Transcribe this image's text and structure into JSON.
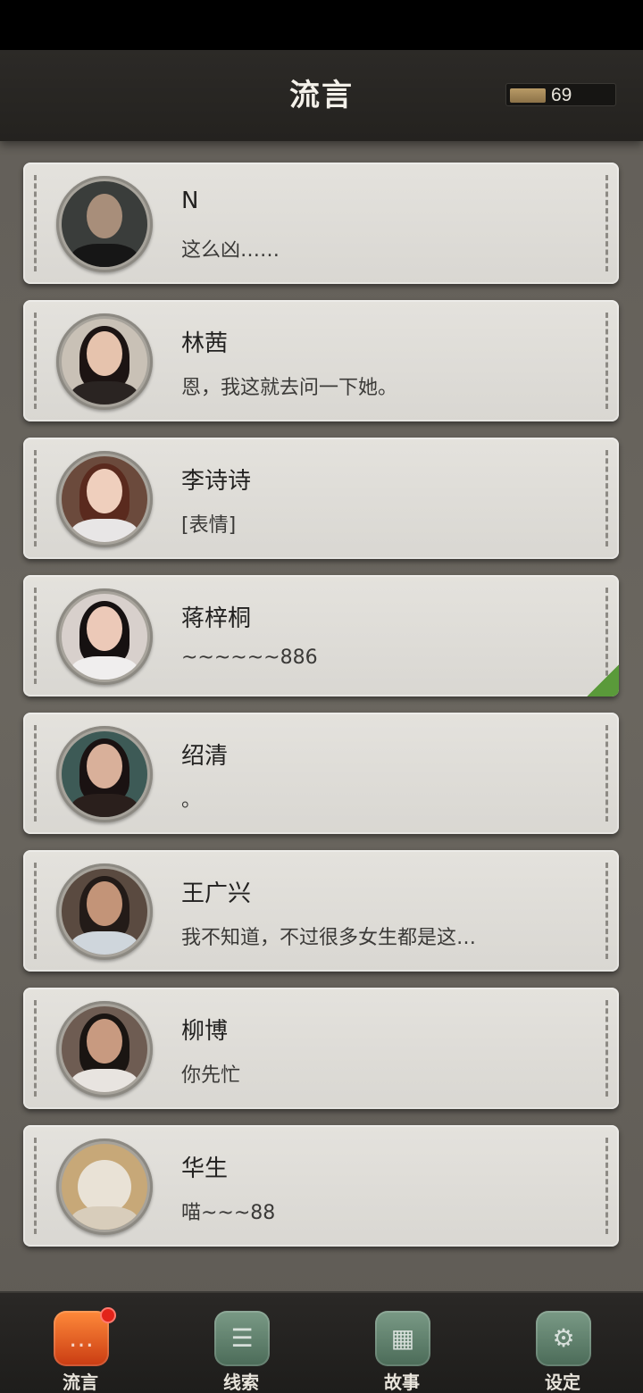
{
  "header": {
    "title": "流言",
    "currency_value": "69"
  },
  "contacts": [
    {
      "name": "N",
      "message": "这么凶……"
    },
    {
      "name": "林茜",
      "message": "恩，我这就去问一下她。"
    },
    {
      "name": "李诗诗",
      "message": "[表情]"
    },
    {
      "name": "蒋梓桐",
      "message": "~~~~~~886"
    },
    {
      "name": "绍清",
      "message": "。"
    },
    {
      "name": "王广兴",
      "message": "我不知道，不过很多女生都是这…"
    },
    {
      "name": "柳博",
      "message": "你先忙"
    },
    {
      "name": "华生",
      "message": "喵~~~88"
    }
  ],
  "tabs": [
    {
      "label": "流言",
      "icon": "chat-bubble-icon",
      "active": true
    },
    {
      "label": "线索",
      "icon": "notebook-icon",
      "active": false
    },
    {
      "label": "故事",
      "icon": "book-icon",
      "active": false
    },
    {
      "label": "设定",
      "icon": "gear-icon",
      "active": false
    }
  ],
  "colors": {
    "accent": "#e2231a",
    "active_tab": "#ff8a3a",
    "inactive_tab": "#5f8a70"
  }
}
